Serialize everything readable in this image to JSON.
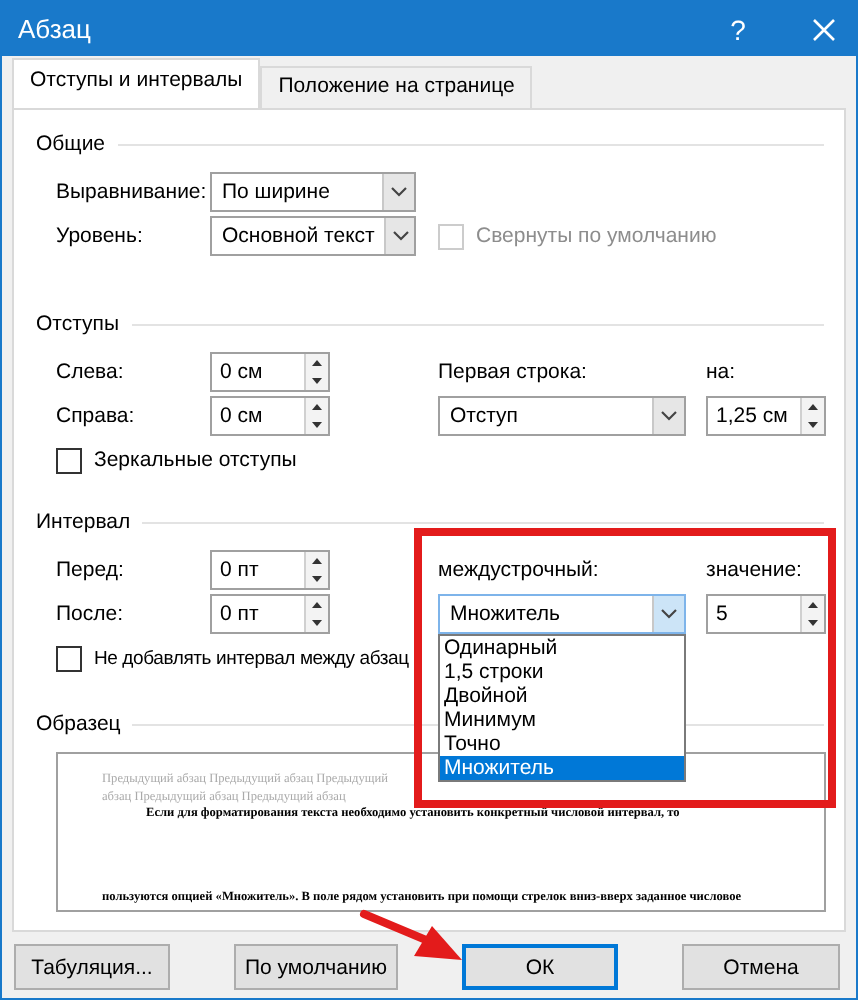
{
  "window": {
    "title": "Абзац",
    "help": "?"
  },
  "tabs": [
    {
      "label": "Отступы и интервалы",
      "selected": true
    },
    {
      "label": "Положение на странице",
      "selected": false
    }
  ],
  "general": {
    "title": "Общие",
    "alignment": {
      "label": "Выравнивание:",
      "value": "По ширине"
    },
    "level": {
      "label": "Уровень:",
      "value": "Основной текст"
    },
    "collapsed": {
      "label": "Свернуты по умолчанию",
      "checked": false,
      "disabled": true
    }
  },
  "indents": {
    "title": "Отступы",
    "left": {
      "label": "Слева:",
      "value": "0 см"
    },
    "right": {
      "label": "Справа:",
      "value": "0 см"
    },
    "first_line": {
      "label": "Первая строка:",
      "value": "Отступ"
    },
    "by": {
      "label": "на:",
      "value": "1,25 см"
    },
    "mirror": {
      "label": "Зеркальные отступы",
      "checked": false,
      "disabled": false
    }
  },
  "spacing": {
    "title": "Интервал",
    "before": {
      "label": "Перед:",
      "value": "0 пт"
    },
    "after": {
      "label": "После:",
      "value": "0 пт"
    },
    "line_spacing": {
      "label": "междустрочный:",
      "value": "Множитель",
      "expanded": true,
      "options": [
        {
          "label": "Одинарный",
          "selected": false
        },
        {
          "label": "1,5 строки",
          "selected": false
        },
        {
          "label": "Двойной",
          "selected": false
        },
        {
          "label": "Минимум",
          "selected": false
        },
        {
          "label": "Точно",
          "selected": false
        },
        {
          "label": "Множитель",
          "selected": true
        }
      ]
    },
    "at": {
      "label": "значение:",
      "value": "5"
    },
    "dont_add": {
      "label": "Не добавлять интервал между абзац",
      "checked": false,
      "disabled": false
    }
  },
  "preview": {
    "title": "Образец",
    "previous": [
      "Предыдущий абзац Предыдущий абзац Предыдущий",
      "абзац Предыдущий абзац Предыдущий абзац"
    ],
    "sample": [
      "Если для форматирования текста необходимо установить конкретный числовой интервал, то",
      "пользуются опцией «Множитель». В поле рядом установить при помощи стрелок вниз-вверх заданное числовое"
    ]
  },
  "buttons": [
    {
      "label": "Табуляция...",
      "default": false
    },
    {
      "label": "По умолчанию",
      "default": false
    },
    {
      "label": "ОК",
      "default": true
    },
    {
      "label": "Отмена",
      "default": false
    }
  ]
}
